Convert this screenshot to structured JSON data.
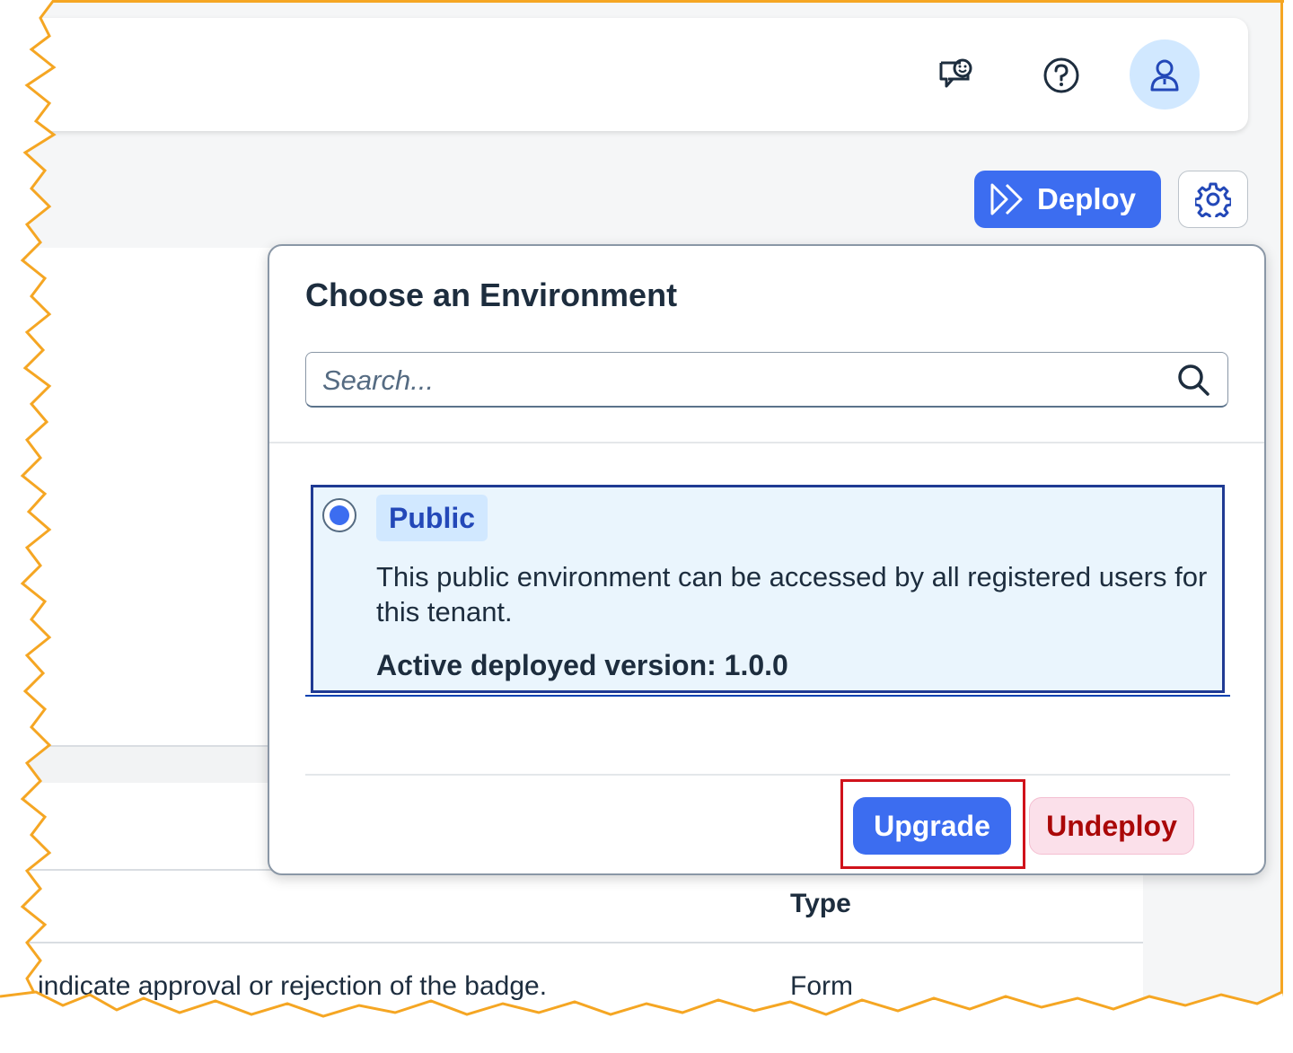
{
  "shellbar": {
    "feedback_icon": "feedback-chat-icon",
    "help_icon": "help-icon",
    "avatar_icon": "user-avatar-icon"
  },
  "toolbar": {
    "deploy_label": "Deploy",
    "deploy_icon": "deploy-forward-icon",
    "settings_icon": "gear-icon"
  },
  "popover": {
    "title": "Choose an Environment",
    "search": {
      "placeholder": "Search...",
      "value": ""
    },
    "environments": [
      {
        "name": "Public",
        "selected": true,
        "description": "This public environment can be accessed by all registered users for this tenant.",
        "active_version": "Active deployed version: 1.0.0"
      }
    ],
    "buttons": {
      "upgrade": "Upgrade",
      "undeploy": "Undeploy"
    }
  },
  "table": {
    "columns": [
      "Type"
    ],
    "rows": [
      {
        "description": "indicate approval or rejection of the badge.",
        "type": "Form"
      }
    ]
  },
  "colors": {
    "accent": "#3c6df0",
    "highlight": "#d0121b",
    "frame": "#f5a623",
    "danger_text": "#aa0808"
  }
}
